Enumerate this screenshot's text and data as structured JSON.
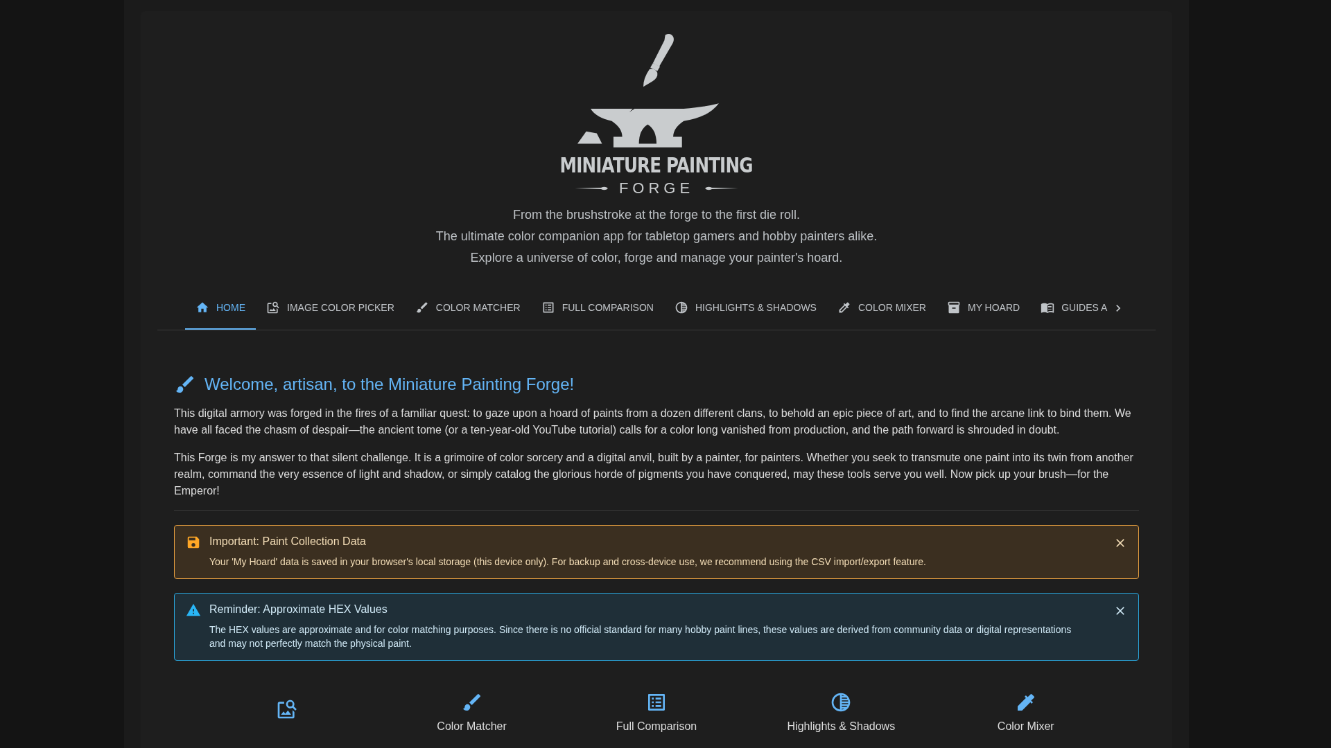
{
  "logo": {
    "title": "MINIATURE PAINTING",
    "subtitle": "FORGE"
  },
  "tagline": [
    "From the brushstroke at the forge to the first die roll.",
    "The ultimate color companion app for tabletop gamers and hobby painters alike.",
    "Explore a universe of color, forge and manage your painter's hoard."
  ],
  "tabs": [
    {
      "label": "HOME",
      "selected": true
    },
    {
      "label": "IMAGE COLOR PICKER",
      "selected": false
    },
    {
      "label": "COLOR MATCHER",
      "selected": false
    },
    {
      "label": "FULL COMPARISON",
      "selected": false
    },
    {
      "label": "HIGHLIGHTS & SHADOWS",
      "selected": false
    },
    {
      "label": "COLOR MIXER",
      "selected": false
    },
    {
      "label": "MY HOARD",
      "selected": false
    },
    {
      "label": "GUIDES A",
      "selected": false
    }
  ],
  "welcome": {
    "heading": "Welcome, artisan, to the Miniature Painting Forge!",
    "paragraphs": [
      "This digital armory was forged in the fires of a familiar quest: to gaze upon a hoard of paints from a dozen different clans, to behold an epic piece of art, and to find the arcane link to bind them. We have all faced the chasm of despair—the ancient tome (or a ten-year-old YouTube tutorial) calls for a color long vanished from production, and the path forward is shrouded in doubt.",
      "This Forge is my answer to that silent challenge. It is a grimoire of color sorcery and a digital anvil, built by a painter, for painters. Whether you seek to transmute one paint into its twin from another realm, command the very essence of light and shadow, or simply catalog the glorious horde of pigments you have conquered, may these tools serve you well. Now pick up your brush—for the Emperor!"
    ]
  },
  "alerts": [
    {
      "kind": "warning",
      "title": "Important: Paint Collection Data",
      "message": "Your 'My Hoard' data is saved in your browser's local storage (this device only). For backup and cross-device use, we recommend using the CSV import/export feature."
    },
    {
      "kind": "info",
      "title": "Reminder: Approximate HEX Values",
      "message": "The HEX values are approximate and for color matching purposes. Since there is no official standard for many hobby paint lines, these values are derived from community data or digital representations and may not perfectly match the physical paint."
    }
  ],
  "features": [
    {
      "kind": "icon"
    },
    {
      "kind": "labeled",
      "label": "Color Matcher"
    },
    {
      "kind": "labeled",
      "label": "Full Comparison"
    },
    {
      "kind": "labeled",
      "label": "Highlights & Shadows"
    },
    {
      "kind": "labeled",
      "label": "Color Mixer"
    }
  ]
}
